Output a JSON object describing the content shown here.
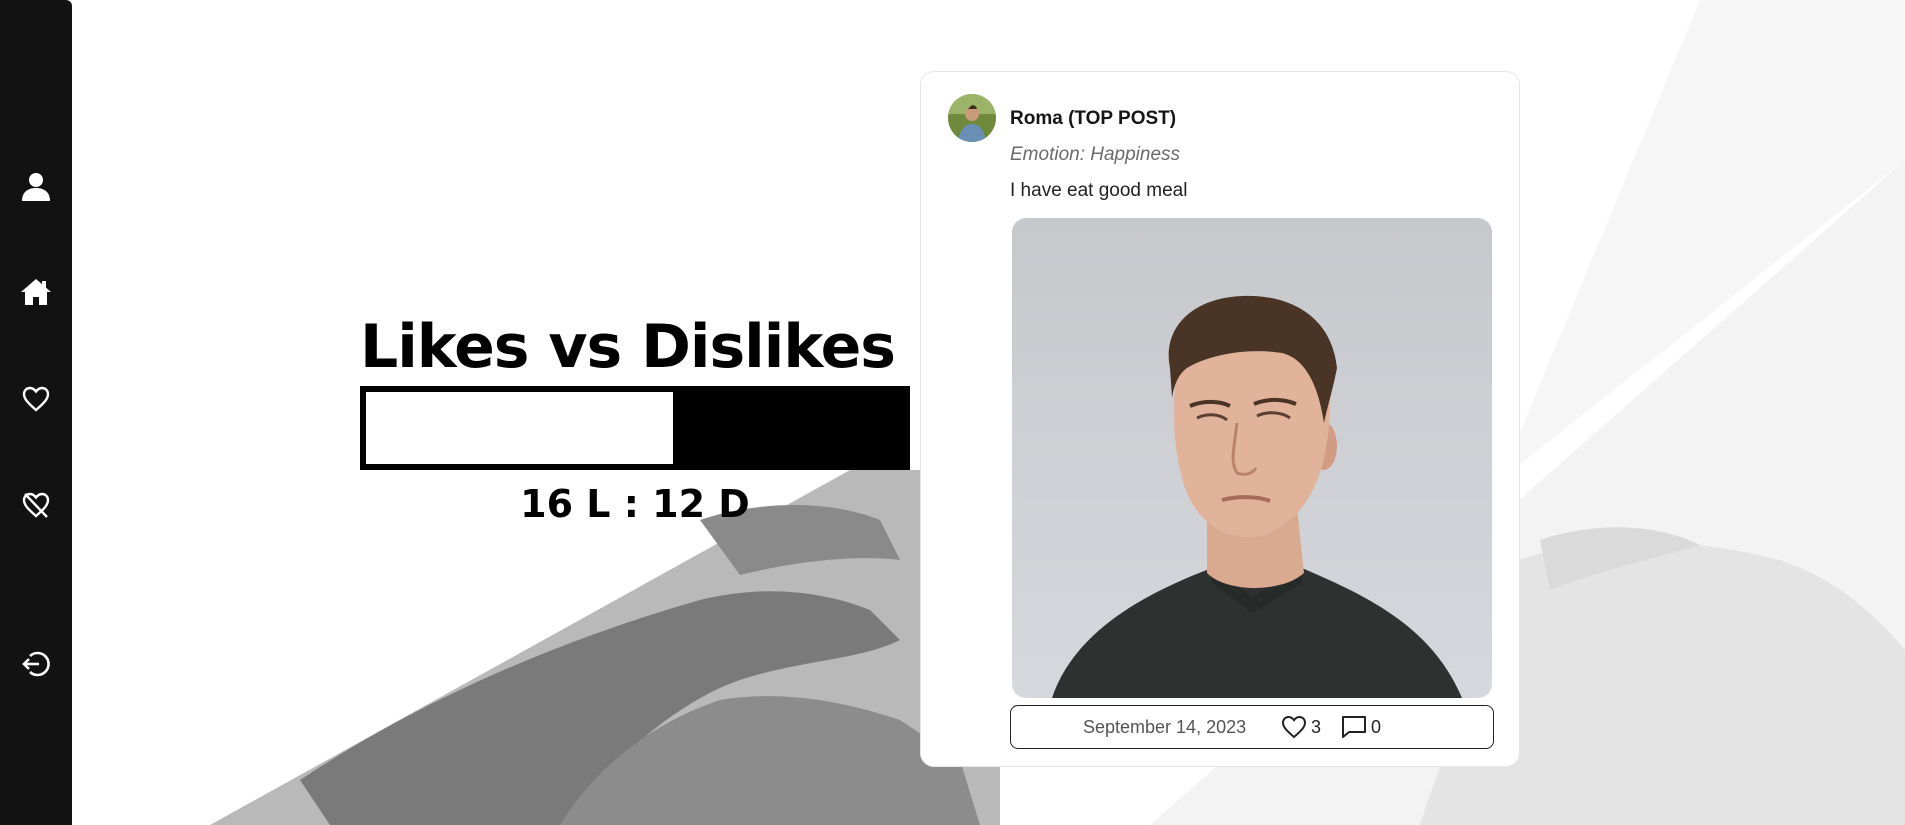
{
  "nav": {
    "items": [
      {
        "name": "profile",
        "icon": "user-icon"
      },
      {
        "name": "home",
        "icon": "home-icon"
      },
      {
        "name": "liked",
        "icon": "heart-icon"
      },
      {
        "name": "disliked",
        "icon": "heart-off-icon"
      },
      {
        "name": "logout",
        "icon": "logout-icon"
      }
    ]
  },
  "stats": {
    "title": "Likes vs Dislikes",
    "likes": 16,
    "dislikes": 12,
    "likes_fraction": 0.571,
    "ratio_text": "16 L : 12 D"
  },
  "post": {
    "author": "Roma (TOP POST)",
    "emotion": "Emotion: Happiness",
    "content": "I have eat good meal",
    "date": "September 14, 2023",
    "likes_count": "3",
    "comments_count": "0"
  },
  "colors": {
    "sidebar": "#121212",
    "text": "#000000",
    "muted": "#6b6b6b"
  }
}
